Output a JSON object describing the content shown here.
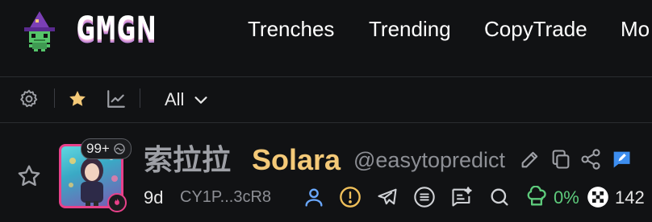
{
  "header": {
    "logo_text": "GMGN",
    "nav": [
      {
        "label": "Trenches"
      },
      {
        "label": "Trending"
      },
      {
        "label": "CopyTrade"
      },
      {
        "label": "Mo"
      }
    ]
  },
  "toolbar": {
    "filter_value": "All",
    "icons": [
      "gear-icon",
      "star-icon",
      "chart-icon",
      "chevron-down-icon"
    ]
  },
  "token": {
    "name": "索拉拉",
    "symbol": "Solara",
    "handle": "@easytopredict",
    "badge_count": "99+",
    "age": "9d",
    "address": "CY1P...3cR8",
    "top10_pct": "0%",
    "holders_partial": "142",
    "colors": {
      "symbol": "#f4c978",
      "accent_pink": "#e8418a",
      "green": "#5ecb7c",
      "blue": "#6aa8ff",
      "yellow": "#f0c05a"
    }
  }
}
